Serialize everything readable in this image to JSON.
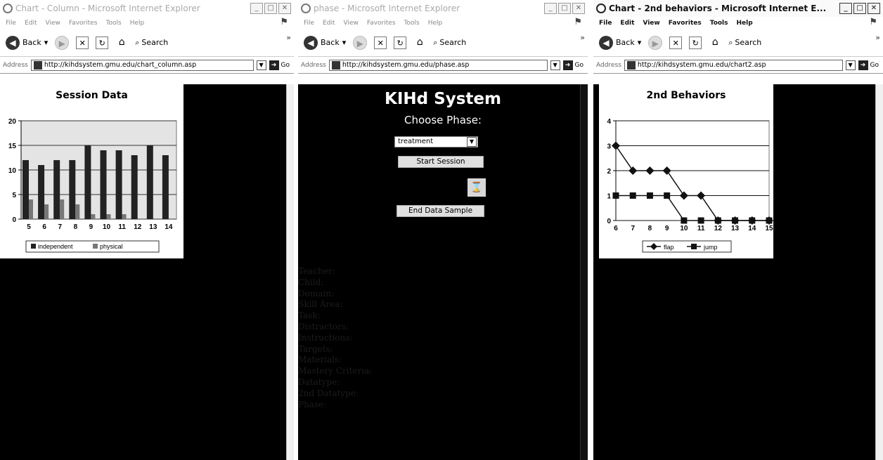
{
  "windows": {
    "left": {
      "title": "Chart - Column - Microsoft Internet Explorer",
      "address": "http://kihdsystem.gmu.edu/chart_column.asp"
    },
    "middle": {
      "title": "phase - Microsoft Internet Explorer",
      "address": "http://kihdsystem.gmu.edu/phase.asp"
    },
    "right": {
      "title": "Chart - 2nd behaviors - Microsoft Internet E...",
      "address": "http://kihdsystem.gmu.edu/chart2.asp"
    }
  },
  "browser": {
    "menu": [
      "File",
      "Edit",
      "View",
      "Favorites",
      "Tools",
      "Help"
    ],
    "back_label": "Back",
    "search_label": "Search",
    "address_label": "Address",
    "go_label": "Go"
  },
  "phase_page": {
    "heading": "KIHd System",
    "choose_label": "Choose Phase:",
    "phase_value": "treatment",
    "start_button": "Start Session",
    "end_button": "End Data Sample",
    "info_lines": [
      "Teacher:",
      "Child:",
      "Domain:",
      "Skill Area:",
      "Task:",
      "Distractors:",
      "Instructions:",
      "Targets:",
      "Materials:",
      "Mastery Criteria:",
      "Datatype:",
      "2nd Datatype:",
      "Phase:"
    ]
  },
  "colors": {
    "page_background": "#000000",
    "chart_background": "#ffffff",
    "series_dark": "#222222",
    "series_light": "#777777"
  },
  "chart_data": [
    {
      "type": "bar",
      "title": "Session Data",
      "categories": [
        "5",
        "6",
        "7",
        "8",
        "9",
        "10",
        "11",
        "12",
        "13",
        "14"
      ],
      "series": [
        {
          "name": "independent",
          "values": [
            12,
            11,
            12,
            12,
            15,
            14,
            14,
            13,
            15,
            13
          ]
        },
        {
          "name": "physical",
          "values": [
            4,
            3,
            4,
            3,
            1,
            1,
            1,
            0,
            0,
            0
          ]
        }
      ],
      "ylim": [
        0,
        20
      ],
      "yticks": [
        "0",
        "5",
        "10",
        "15",
        "20"
      ],
      "legend": "bottom"
    },
    {
      "type": "line",
      "title": "2nd Behaviors",
      "categories": [
        "6",
        "7",
        "8",
        "9",
        "10",
        "11",
        "12",
        "13",
        "14",
        "15"
      ],
      "series": [
        {
          "name": "flap",
          "values": [
            3,
            2,
            2,
            2,
            1,
            1,
            0,
            0,
            0,
            0
          ]
        },
        {
          "name": "jump",
          "values": [
            1,
            1,
            1,
            1,
            0,
            0,
            0,
            0,
            0,
            0
          ]
        }
      ],
      "ylim": [
        0,
        4
      ],
      "yticks": [
        "0",
        "1",
        "2",
        "3",
        "4"
      ],
      "legend": "bottom"
    }
  ]
}
